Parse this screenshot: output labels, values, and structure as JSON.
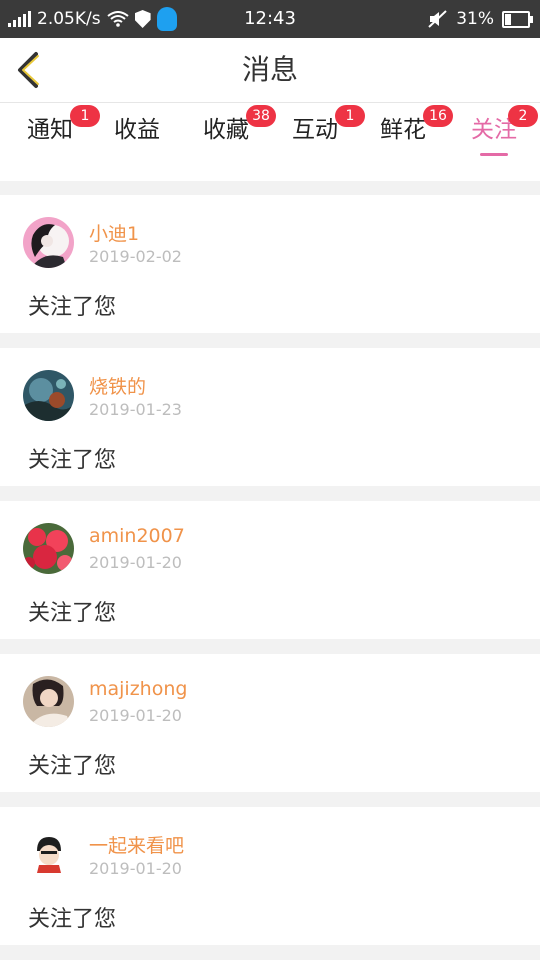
{
  "status_bar": {
    "speed": "2.05K/s",
    "time": "12:43",
    "battery": "31%",
    "battery_level": 0.31
  },
  "header": {
    "title": "消息"
  },
  "tabs": [
    {
      "label": "通知",
      "badge": "1"
    },
    {
      "label": "收益",
      "badge": ""
    },
    {
      "label": "收藏",
      "badge": "38"
    },
    {
      "label": "互动",
      "badge": "1"
    },
    {
      "label": "鲜花",
      "badge": "16"
    },
    {
      "label": "关注",
      "badge": "2",
      "active": true
    }
  ],
  "followers": [
    {
      "name": "小迪1",
      "date": "2019-02-02",
      "text": "关注了您"
    },
    {
      "name": "烧铁的",
      "date": "2019-01-23",
      "text": "关注了您"
    },
    {
      "name": "amin2007",
      "date": "2019-01-20",
      "text": "关注了您"
    },
    {
      "name": "majizhong",
      "date": "2019-01-20",
      "text": "关注了您"
    },
    {
      "name": "一起来看吧",
      "date": "2019-01-20",
      "text": "关注了您"
    }
  ],
  "colors": {
    "accent": "#e46aa6",
    "name": "#f0934a",
    "badge": "#ee3344"
  }
}
